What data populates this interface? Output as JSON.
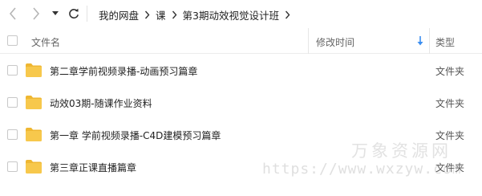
{
  "icons": {
    "back": "chevron-left-icon",
    "forward": "chevron-right-icon",
    "history": "caret-down-icon",
    "refresh": "refresh-icon",
    "breadcrumb_separator": "chevron-right-icon",
    "folder": "folder-icon",
    "sort": "sort-down-arrow-icon"
  },
  "colors": {
    "folder": "#f7c84c",
    "folder_tab": "#efb732",
    "sort_arrow": "#3b8ef0",
    "nav_disabled": "#b5b5b5",
    "nav_enabled": "#333333"
  },
  "breadcrumb": {
    "items": [
      "我的网盘",
      "课",
      "第3期动效视觉设计班"
    ]
  },
  "table": {
    "columns": {
      "name": "文件名",
      "modified": "修改时间",
      "type": "类型"
    },
    "sort": {
      "column": "modified",
      "direction": "descending"
    },
    "rows": [
      {
        "name": "第二章学前视频录播-动画预习篇章",
        "type": "文件夹"
      },
      {
        "name": "动效03期-随课作业资料",
        "type": "文件夹"
      },
      {
        "name": "第一章 学前视频录播-C4D建模预习篇章",
        "type": "文件夹"
      },
      {
        "name": "第三章正课直播篇章",
        "type": "文件夹"
      }
    ]
  },
  "watermark": {
    "title": "万象资源网",
    "url": "https://www.wxzyw.com"
  }
}
